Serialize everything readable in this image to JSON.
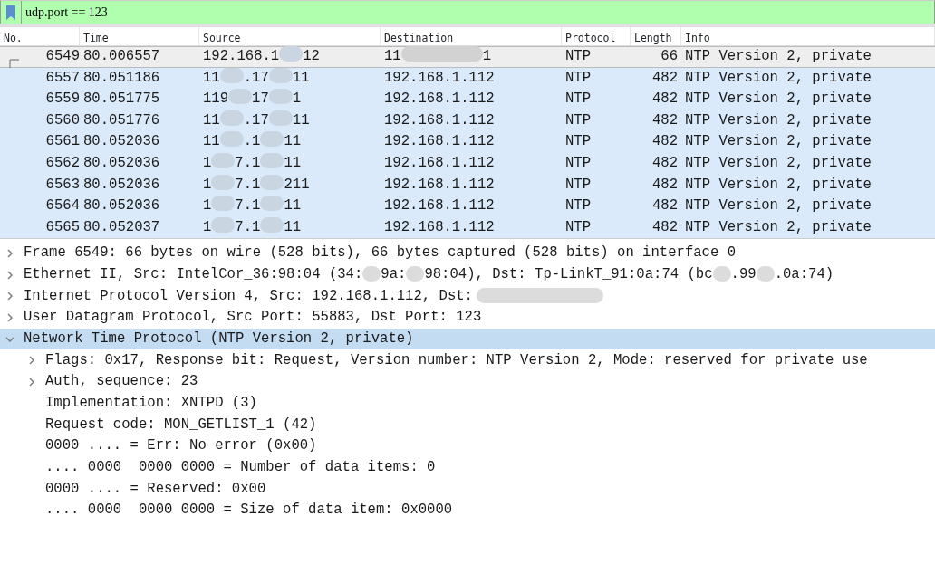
{
  "filter": {
    "value": "udp.port == 123"
  },
  "packet_list": {
    "columns": [
      "No.",
      "Time",
      "Source",
      "Destination",
      "Protocol",
      "Length",
      "Info"
    ],
    "rows": [
      {
        "selected": true,
        "cells": [
          [
            "6549"
          ],
          [
            "80.006557"
          ],
          [
            "192.168.1",
            "12"
          ],
          [
            "11",
            "1"
          ],
          [
            "NTP"
          ],
          [
            "66"
          ],
          [
            "NTP Version 2, private"
          ]
        ]
      },
      {
        "selected": false,
        "cells": [
          [
            "6557"
          ],
          [
            "80.051186"
          ],
          [
            "11",
            ".17",
            "11"
          ],
          [
            "192.168.1.112"
          ],
          [
            "NTP"
          ],
          [
            "482"
          ],
          [
            "NTP Version 2, private"
          ]
        ]
      },
      {
        "selected": false,
        "cells": [
          [
            "6559"
          ],
          [
            "80.051775"
          ],
          [
            "119",
            "17",
            "1"
          ],
          [
            "192.168.1.112"
          ],
          [
            "NTP"
          ],
          [
            "482"
          ],
          [
            "NTP Version 2, private"
          ]
        ]
      },
      {
        "selected": false,
        "cells": [
          [
            "6560"
          ],
          [
            "80.051776"
          ],
          [
            "11",
            ".17",
            "11"
          ],
          [
            "192.168.1.112"
          ],
          [
            "NTP"
          ],
          [
            "482"
          ],
          [
            "NTP Version 2, private"
          ]
        ]
      },
      {
        "selected": false,
        "cells": [
          [
            "6561"
          ],
          [
            "80.052036"
          ],
          [
            "11",
            ".1",
            "11"
          ],
          [
            "192.168.1.112"
          ],
          [
            "NTP"
          ],
          [
            "482"
          ],
          [
            "NTP Version 2, private"
          ]
        ]
      },
      {
        "selected": false,
        "cells": [
          [
            "6562"
          ],
          [
            "80.052036"
          ],
          [
            "1",
            "7.1",
            "11"
          ],
          [
            "192.168.1.112"
          ],
          [
            "NTP"
          ],
          [
            "482"
          ],
          [
            "NTP Version 2, private"
          ]
        ]
      },
      {
        "selected": false,
        "cells": [
          [
            "6563"
          ],
          [
            "80.052036"
          ],
          [
            "1",
            "7.1",
            "211"
          ],
          [
            "192.168.1.112"
          ],
          [
            "NTP"
          ],
          [
            "482"
          ],
          [
            "NTP Version 2, private"
          ]
        ]
      },
      {
        "selected": false,
        "cells": [
          [
            "6564"
          ],
          [
            "80.052036"
          ],
          [
            "1",
            "7.1",
            "11"
          ],
          [
            "192.168.1.112"
          ],
          [
            "NTP"
          ],
          [
            "482"
          ],
          [
            "NTP Version 2, private"
          ]
        ]
      },
      {
        "selected": false,
        "cells": [
          [
            "6565"
          ],
          [
            "80.052037"
          ],
          [
            "1",
            "7.1",
            "11"
          ],
          [
            "192.168.1.112"
          ],
          [
            "NTP"
          ],
          [
            "482"
          ],
          [
            "NTP Version 2, private"
          ]
        ]
      }
    ]
  },
  "details": [
    {
      "parts": [
        "Frame 6549: 66 bytes on wire (528 bits), 66 bytes captured (528 bits) on interface 0"
      ],
      "expanded": false,
      "selected": false
    },
    {
      "parts": [
        "Ethernet II, Src: IntelCor_36:98:04 (34:",
        "9a:",
        "98:04), Dst: Tp-LinkT_91:0a:74 (bc",
        ".99",
        ".0a:74)"
      ],
      "expanded": false,
      "selected": false
    },
    {
      "parts": [
        "Internet Protocol Version 4, Src: 192.168.1.112, Dst:"
      ],
      "redacted_end": true,
      "expanded": false,
      "selected": false
    },
    {
      "parts": [
        "User Datagram Protocol, Src Port: 55883, Dst Port: 123"
      ],
      "expanded": false,
      "selected": false
    },
    {
      "parts": [
        "Network Time Protocol (NTP Version 2, private)"
      ],
      "expanded": true,
      "selected": true,
      "children": [
        {
          "parts": [
            "Flags: 0x17, Response bit: Request, Version number: NTP Version 2, Mode: reserved for private use"
          ],
          "expanded": false,
          "selected": false
        },
        {
          "parts": [
            "Auth, sequence: 23"
          ],
          "expanded": false,
          "selected": false
        },
        {
          "parts": [
            "Implementation: XNTPD (3)"
          ],
          "selected": false
        },
        {
          "parts": [
            "Request code: MON_GETLIST_1 (42)"
          ],
          "selected": false
        },
        {
          "parts": [
            "0000 .... = Err: No error (0x00)"
          ],
          "selected": false
        },
        {
          "parts": [
            ".... 0000  0000 0000 = Number of data items: 0"
          ],
          "selected": false
        },
        {
          "parts": [
            "0000 .... = Reserved: 0x00"
          ],
          "selected": false
        },
        {
          "parts": [
            ".... 0000  0000 0000 = Size of data item: 0x0000"
          ],
          "selected": false
        }
      ]
    }
  ]
}
